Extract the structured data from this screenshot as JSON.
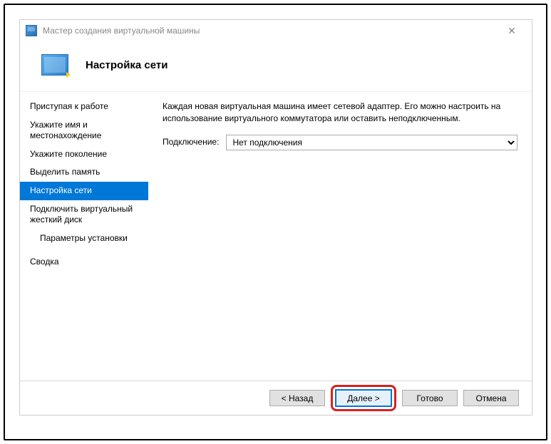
{
  "window": {
    "title": "Мастер создания виртуальной машины"
  },
  "header": {
    "title": "Настройка сети"
  },
  "sidebar": {
    "items": [
      {
        "label": "Приступая к работе",
        "sub": false
      },
      {
        "label": "Укажите имя и местонахождение",
        "sub": false
      },
      {
        "label": "Укажите поколение",
        "sub": false
      },
      {
        "label": "Выделить память",
        "sub": false
      },
      {
        "label": "Настройка сети",
        "sub": false,
        "selected": true
      },
      {
        "label": "Подключить виртуальный жесткий диск",
        "sub": false
      },
      {
        "label": "Параметры установки",
        "sub": true
      },
      {
        "label": "Сводка",
        "sub": false
      }
    ]
  },
  "content": {
    "description": "Каждая новая виртуальная машина имеет сетевой адаптер. Его можно настроить на использование виртуального коммутатора или оставить неподключенным.",
    "connection_label": "Подключение:",
    "connection_value": "Нет подключения"
  },
  "footer": {
    "back": "< Назад",
    "next": "Далее >",
    "finish": "Готово",
    "cancel": "Отмена"
  }
}
